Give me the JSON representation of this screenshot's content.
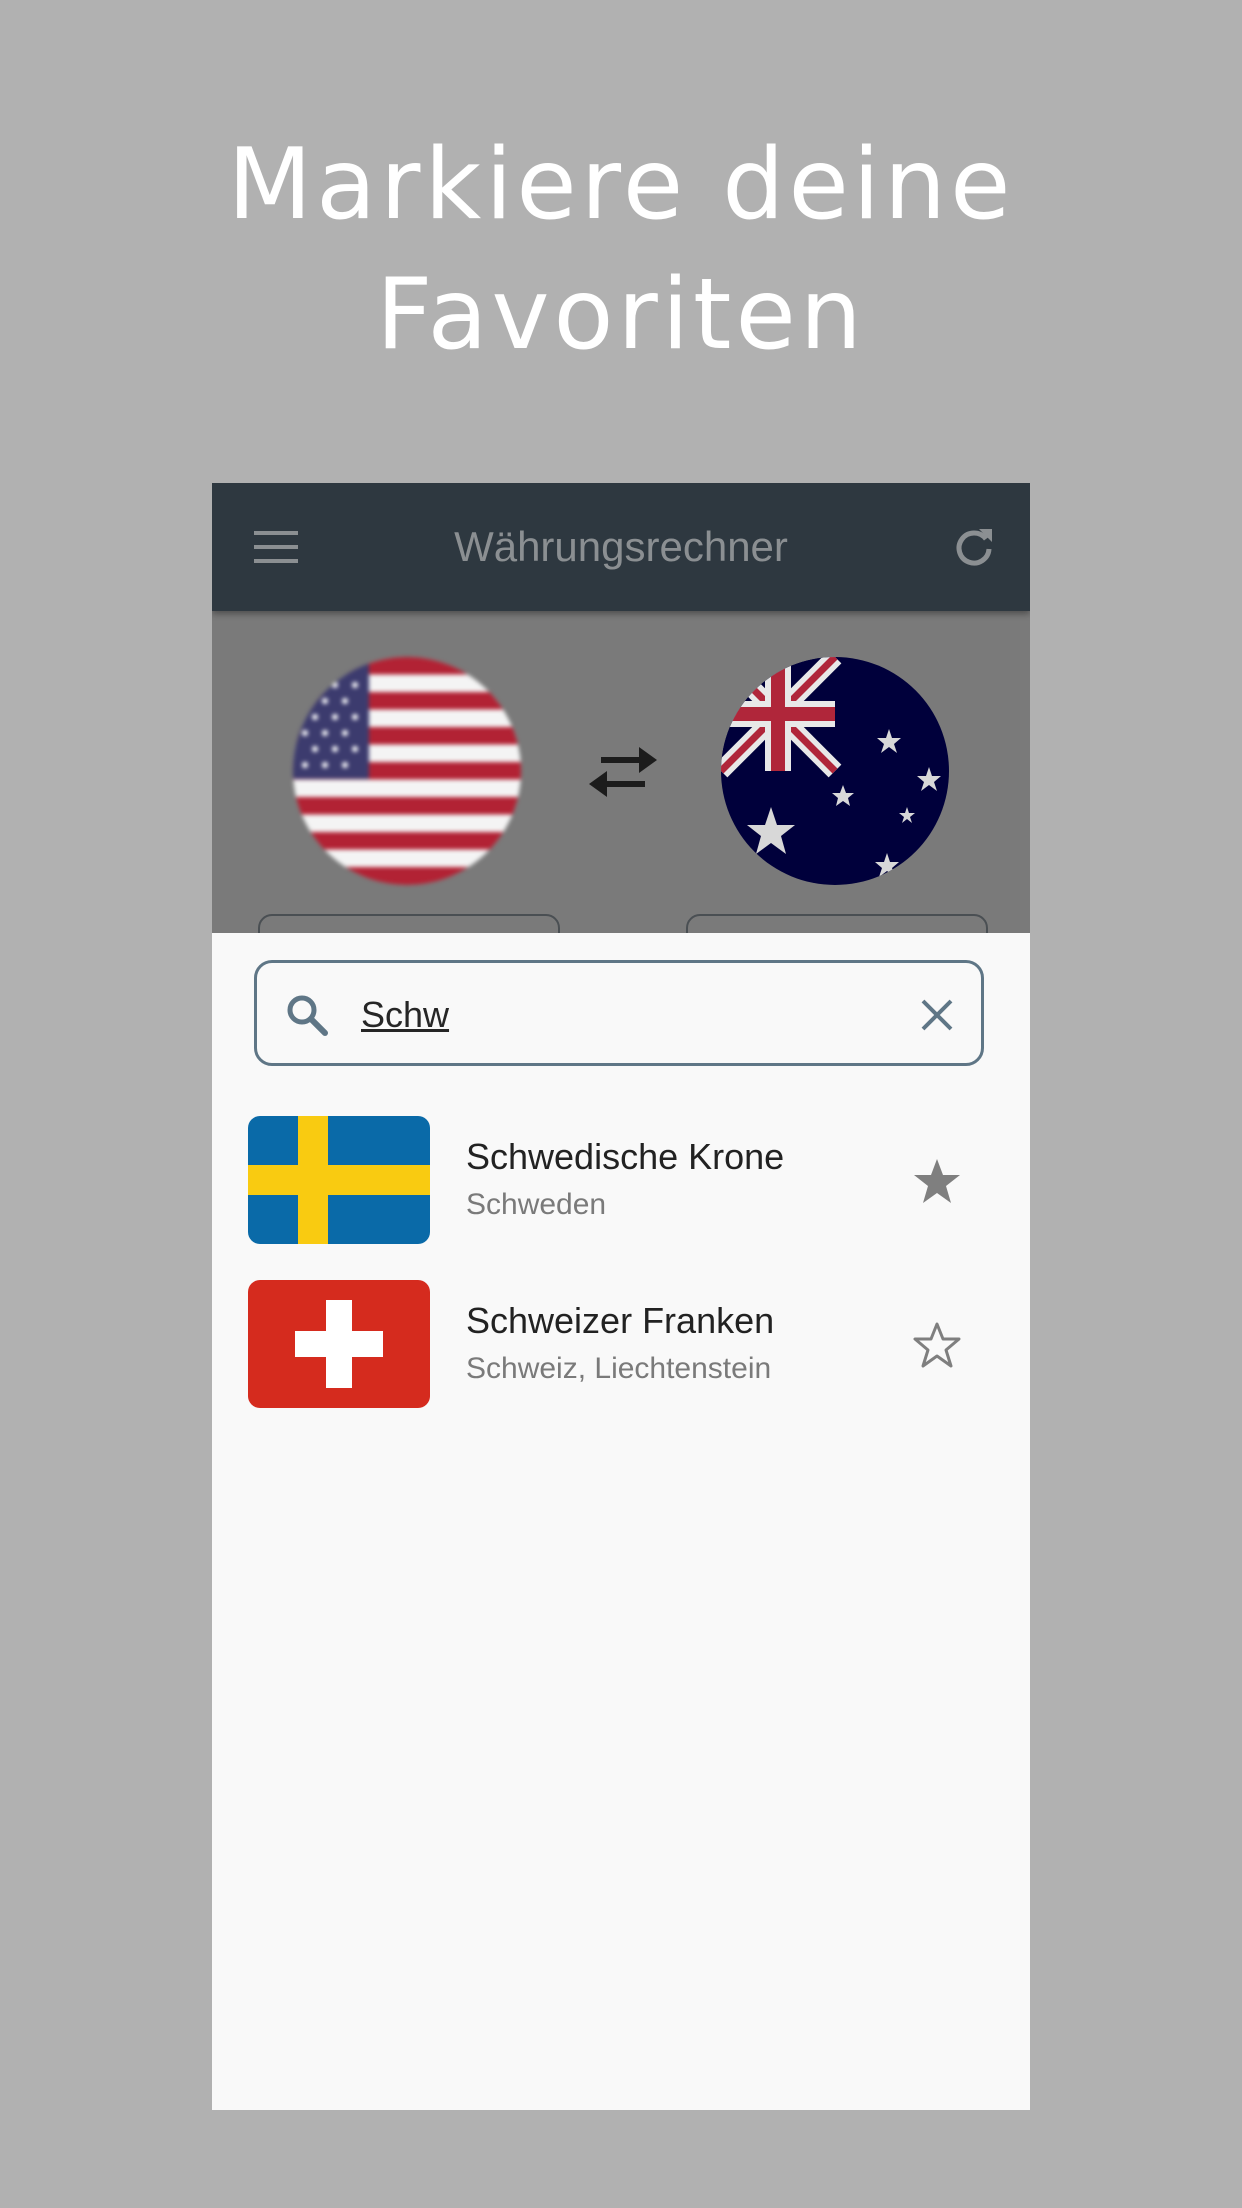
{
  "promo": {
    "headline_line1": "Markiere deine",
    "headline_line2": "Favoriten"
  },
  "app": {
    "title": "Währungsrechner",
    "menu_icon": "menu-icon",
    "refresh_icon": "refresh-icon",
    "header_color": "#2e3840"
  },
  "converter": {
    "from_flag": "us-flag",
    "to_flag": "au-flag",
    "swap_icon": "swap-arrows-icon"
  },
  "search": {
    "value": "Schw",
    "search_icon": "search-icon",
    "clear_icon": "close-icon",
    "border_color": "#5f7686"
  },
  "results": [
    {
      "name": "Schwedische Krone",
      "countries": "Schweden",
      "flag": "sweden-flag",
      "favorite": true
    },
    {
      "name": "Schweizer Franken",
      "countries": "Schweiz, Liechtenstein",
      "flag": "switzerland-flag",
      "favorite": false
    }
  ]
}
